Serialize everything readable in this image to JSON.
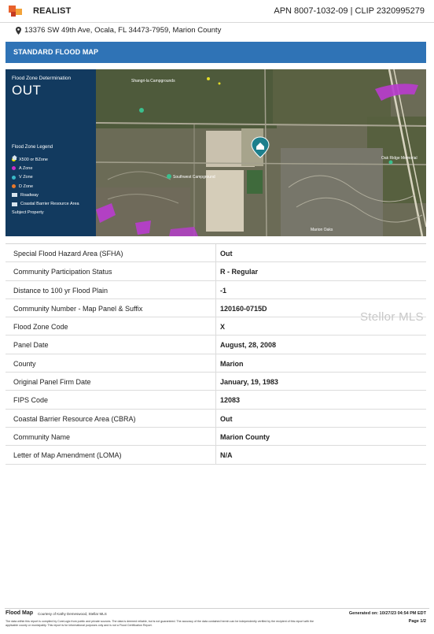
{
  "header": {
    "brand": "REALIST",
    "apn_clip": "APN 8007-1032-09 | CLIP 2320995279"
  },
  "address": "13376 SW 49th Ave, Ocala, FL 34473-7959, Marion County",
  "banner_title": "STANDARD FLOOD MAP",
  "map": {
    "zone_label": "Flood Zone Determination",
    "zone_value": "OUT",
    "legend_title": "Flood Zone Legend",
    "legend": [
      {
        "icon": "yellow-dot",
        "label": "X500 or BZone",
        "color": "#f2e600"
      },
      {
        "icon": "purple-dot",
        "label": "A Zone",
        "color": "#c830c8"
      },
      {
        "icon": "cyan-dot",
        "label": "V Zone",
        "color": "#3ab9c8"
      },
      {
        "icon": "orange-dot",
        "label": "D Zone",
        "color": "#e8782a"
      },
      {
        "icon": "square",
        "label": "Roadway"
      },
      {
        "icon": "square",
        "label": "Coastal Barrier Resource Area"
      },
      {
        "icon": "house-icon",
        "label": "Subject Property"
      }
    ],
    "place_labels": [
      "Shangri-la Campgrounds",
      "Southwest Campground",
      "Marion Oaks",
      "Oak Ridge Memorial"
    ]
  },
  "rows": [
    {
      "key": "Special Flood Hazard Area (SFHA)",
      "value": "Out"
    },
    {
      "key": "Community Participation Status",
      "value": "R - Regular"
    },
    {
      "key": "Distance to 100 yr Flood Plain",
      "value": "-1"
    },
    {
      "key": "Community Number - Map Panel & Suffix",
      "value": "120160-0715D"
    },
    {
      "key": "Flood Zone Code",
      "value": "X"
    },
    {
      "key": "Panel Date",
      "value": "August, 28, 2008"
    },
    {
      "key": "County",
      "value": "Marion"
    },
    {
      "key": "Original Panel Firm Date",
      "value": "January, 19, 1983"
    },
    {
      "key": "FIPS Code",
      "value": "12083"
    },
    {
      "key": "Coastal Barrier Resource Area (CBRA)",
      "value": "Out"
    },
    {
      "key": "Community Name",
      "value": "Marion County"
    },
    {
      "key": "Letter of Map Amendment (LOMA)",
      "value": "N/A"
    }
  ],
  "watermark": "Stellor MLS",
  "footer": {
    "title": "Flood Map",
    "courtesy": "Courtesy of Kathy Demeswood, Stellar MLS",
    "generated": "Generated on: 10/27/23 04:54 PM EDT",
    "disclaimer": "The data within this report is compiled by CoreLogic from public and private sources. The data is deemed reliable, but is not guaranteed. The accuracy of the data contained herein can be independently verified by the recipient of this report with the applicable county or municipality. This report is for informational purposes only and is not a Flood Certification Report.",
    "page": "Page 1/2"
  }
}
